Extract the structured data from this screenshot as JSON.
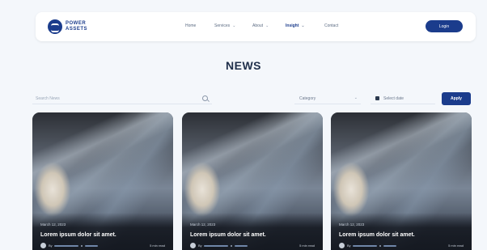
{
  "brand": {
    "line1": "POWER",
    "line2": "ASSETS"
  },
  "nav": {
    "items": [
      {
        "label": "Home"
      },
      {
        "label": "Services"
      },
      {
        "label": "About"
      },
      {
        "label": "Insight"
      },
      {
        "label": "Contact"
      }
    ],
    "active": "Insight",
    "login_label": "Login"
  },
  "page": {
    "title": "NEWS"
  },
  "filters": {
    "search_placeholder": "Search News",
    "category_label": "Category",
    "date_label": "Select date",
    "apply_label": "Apply"
  },
  "cards": [
    {
      "date": "March 12, 2023",
      "title": "Lorem ipsum dolor sit amet.",
      "by": "By",
      "read_time": "5 min read"
    },
    {
      "date": "March 12, 2023",
      "title": "Lorem ipsum dolor sit amet.",
      "by": "By",
      "read_time": "5 min read"
    },
    {
      "date": "March 12, 2023",
      "title": "Lorem ipsum dolor sit amet.",
      "by": "By",
      "read_time": "5 min read"
    }
  ],
  "colors": {
    "primary": "#1b3c8c",
    "background": "#f4f7fb",
    "heading": "#1f2f4a"
  }
}
